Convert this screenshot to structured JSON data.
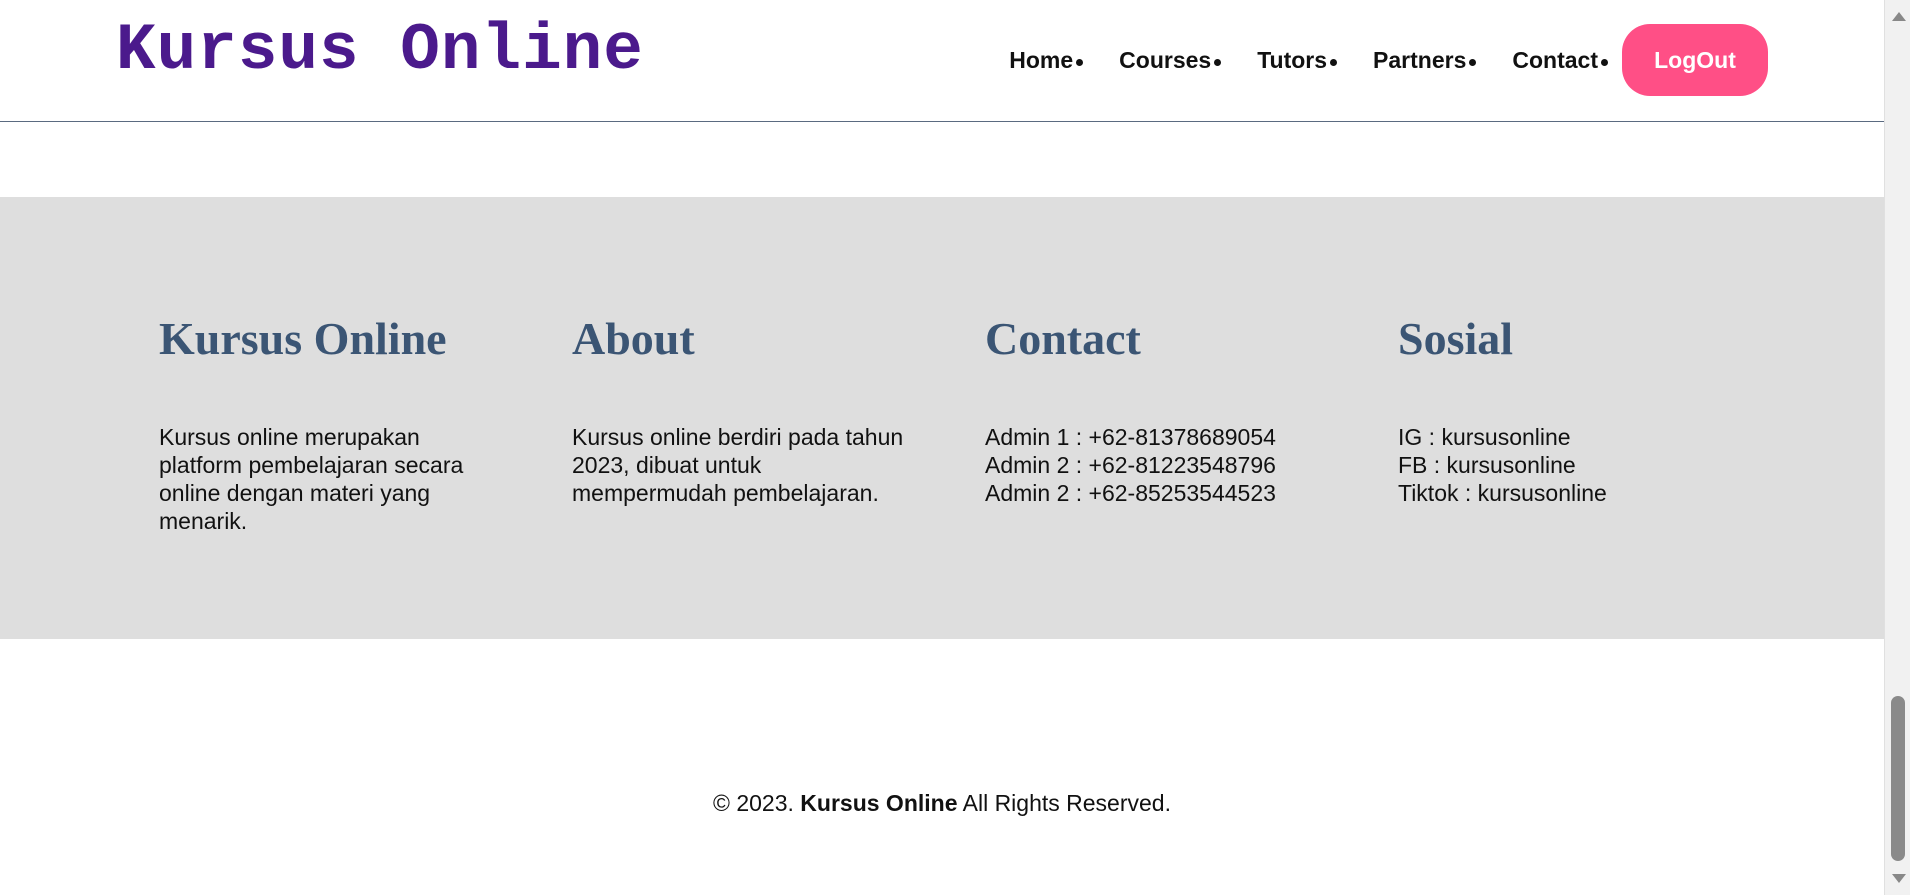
{
  "header": {
    "logo": "Kursus Online",
    "nav": [
      {
        "label": "Home"
      },
      {
        "label": "Courses"
      },
      {
        "label": "Tutors"
      },
      {
        "label": "Partners"
      },
      {
        "label": "Contact"
      }
    ],
    "logout_label": "LogOut"
  },
  "footer": {
    "columns": [
      {
        "title": "Kursus Online",
        "lines": [
          "Kursus online merupakan platform pembelajaran secara online dengan materi yang menarik."
        ]
      },
      {
        "title": "About",
        "lines": [
          "Kursus online berdiri pada tahun 2023, dibuat untuk mempermudah pembelajaran."
        ]
      },
      {
        "title": "Contact",
        "lines": [
          "Admin 1 : +62-81378689054",
          "Admin 2 : +62-81223548796",
          "Admin 2 : +62-85253544523"
        ]
      },
      {
        "title": "Sosial",
        "lines": [
          "IG : kursusonline",
          "FB : kursusonline",
          "Tiktok : kursusonline"
        ]
      }
    ],
    "copyright": {
      "prefix": "© 2023.",
      "brand": "Kursus Online",
      "suffix": "All Rights Reserved."
    }
  },
  "colors": {
    "logo": "#4b1a8c",
    "logout_bg": "#ff4f86",
    "heading": "#3b5574",
    "band_bg": "#dedede"
  }
}
